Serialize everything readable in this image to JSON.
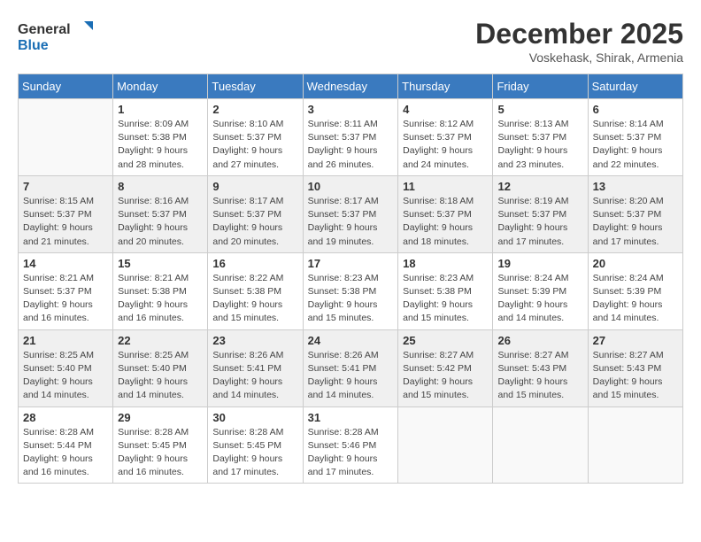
{
  "logo": {
    "line1": "General",
    "line2": "Blue"
  },
  "title": "December 2025",
  "subtitle": "Voskehask, Shirak, Armenia",
  "weekdays": [
    "Sunday",
    "Monday",
    "Tuesday",
    "Wednesday",
    "Thursday",
    "Friday",
    "Saturday"
  ],
  "weeks": [
    [
      {
        "day": "",
        "info": ""
      },
      {
        "day": "1",
        "info": "Sunrise: 8:09 AM\nSunset: 5:38 PM\nDaylight: 9 hours\nand 28 minutes."
      },
      {
        "day": "2",
        "info": "Sunrise: 8:10 AM\nSunset: 5:37 PM\nDaylight: 9 hours\nand 27 minutes."
      },
      {
        "day": "3",
        "info": "Sunrise: 8:11 AM\nSunset: 5:37 PM\nDaylight: 9 hours\nand 26 minutes."
      },
      {
        "day": "4",
        "info": "Sunrise: 8:12 AM\nSunset: 5:37 PM\nDaylight: 9 hours\nand 24 minutes."
      },
      {
        "day": "5",
        "info": "Sunrise: 8:13 AM\nSunset: 5:37 PM\nDaylight: 9 hours\nand 23 minutes."
      },
      {
        "day": "6",
        "info": "Sunrise: 8:14 AM\nSunset: 5:37 PM\nDaylight: 9 hours\nand 22 minutes."
      }
    ],
    [
      {
        "day": "7",
        "info": "Sunrise: 8:15 AM\nSunset: 5:37 PM\nDaylight: 9 hours\nand 21 minutes."
      },
      {
        "day": "8",
        "info": "Sunrise: 8:16 AM\nSunset: 5:37 PM\nDaylight: 9 hours\nand 20 minutes."
      },
      {
        "day": "9",
        "info": "Sunrise: 8:17 AM\nSunset: 5:37 PM\nDaylight: 9 hours\nand 20 minutes."
      },
      {
        "day": "10",
        "info": "Sunrise: 8:17 AM\nSunset: 5:37 PM\nDaylight: 9 hours\nand 19 minutes."
      },
      {
        "day": "11",
        "info": "Sunrise: 8:18 AM\nSunset: 5:37 PM\nDaylight: 9 hours\nand 18 minutes."
      },
      {
        "day": "12",
        "info": "Sunrise: 8:19 AM\nSunset: 5:37 PM\nDaylight: 9 hours\nand 17 minutes."
      },
      {
        "day": "13",
        "info": "Sunrise: 8:20 AM\nSunset: 5:37 PM\nDaylight: 9 hours\nand 17 minutes."
      }
    ],
    [
      {
        "day": "14",
        "info": "Sunrise: 8:21 AM\nSunset: 5:37 PM\nDaylight: 9 hours\nand 16 minutes."
      },
      {
        "day": "15",
        "info": "Sunrise: 8:21 AM\nSunset: 5:38 PM\nDaylight: 9 hours\nand 16 minutes."
      },
      {
        "day": "16",
        "info": "Sunrise: 8:22 AM\nSunset: 5:38 PM\nDaylight: 9 hours\nand 15 minutes."
      },
      {
        "day": "17",
        "info": "Sunrise: 8:23 AM\nSunset: 5:38 PM\nDaylight: 9 hours\nand 15 minutes."
      },
      {
        "day": "18",
        "info": "Sunrise: 8:23 AM\nSunset: 5:38 PM\nDaylight: 9 hours\nand 15 minutes."
      },
      {
        "day": "19",
        "info": "Sunrise: 8:24 AM\nSunset: 5:39 PM\nDaylight: 9 hours\nand 14 minutes."
      },
      {
        "day": "20",
        "info": "Sunrise: 8:24 AM\nSunset: 5:39 PM\nDaylight: 9 hours\nand 14 minutes."
      }
    ],
    [
      {
        "day": "21",
        "info": "Sunrise: 8:25 AM\nSunset: 5:40 PM\nDaylight: 9 hours\nand 14 minutes."
      },
      {
        "day": "22",
        "info": "Sunrise: 8:25 AM\nSunset: 5:40 PM\nDaylight: 9 hours\nand 14 minutes."
      },
      {
        "day": "23",
        "info": "Sunrise: 8:26 AM\nSunset: 5:41 PM\nDaylight: 9 hours\nand 14 minutes."
      },
      {
        "day": "24",
        "info": "Sunrise: 8:26 AM\nSunset: 5:41 PM\nDaylight: 9 hours\nand 14 minutes."
      },
      {
        "day": "25",
        "info": "Sunrise: 8:27 AM\nSunset: 5:42 PM\nDaylight: 9 hours\nand 15 minutes."
      },
      {
        "day": "26",
        "info": "Sunrise: 8:27 AM\nSunset: 5:43 PM\nDaylight: 9 hours\nand 15 minutes."
      },
      {
        "day": "27",
        "info": "Sunrise: 8:27 AM\nSunset: 5:43 PM\nDaylight: 9 hours\nand 15 minutes."
      }
    ],
    [
      {
        "day": "28",
        "info": "Sunrise: 8:28 AM\nSunset: 5:44 PM\nDaylight: 9 hours\nand 16 minutes."
      },
      {
        "day": "29",
        "info": "Sunrise: 8:28 AM\nSunset: 5:45 PM\nDaylight: 9 hours\nand 16 minutes."
      },
      {
        "day": "30",
        "info": "Sunrise: 8:28 AM\nSunset: 5:45 PM\nDaylight: 9 hours\nand 17 minutes."
      },
      {
        "day": "31",
        "info": "Sunrise: 8:28 AM\nSunset: 5:46 PM\nDaylight: 9 hours\nand 17 minutes."
      },
      {
        "day": "",
        "info": ""
      },
      {
        "day": "",
        "info": ""
      },
      {
        "day": "",
        "info": ""
      }
    ]
  ]
}
